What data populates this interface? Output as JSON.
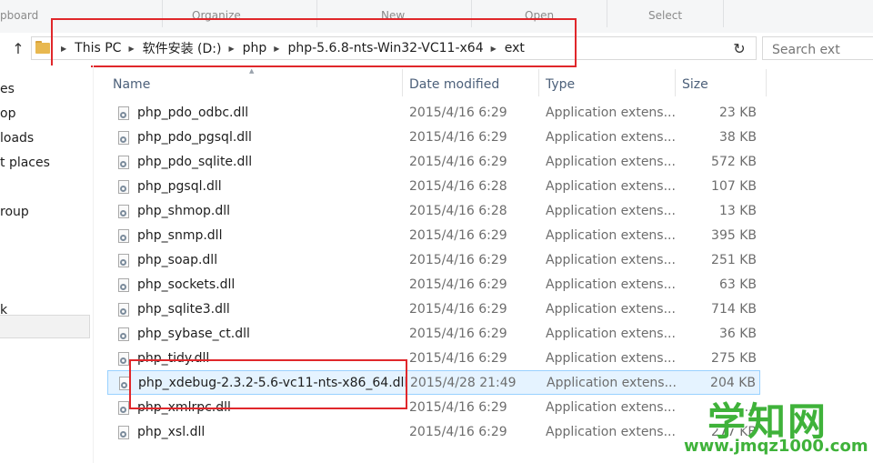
{
  "ribbon": {
    "groups": [
      "pboard",
      "Organize",
      "New",
      "Open",
      "Select"
    ]
  },
  "address": {
    "crumbs": [
      "This PC",
      "软件安装 (D:)",
      "php",
      "php-5.6.8-nts-Win32-VC11-x64",
      "ext"
    ]
  },
  "search": {
    "placeholder": "Search ext"
  },
  "nav": {
    "items": [
      "es",
      "op",
      "loads",
      "t places",
      "roup",
      "k"
    ]
  },
  "columns": {
    "name": "Name",
    "date": "Date modified",
    "type": "Type",
    "size": "Size"
  },
  "files": [
    {
      "name": "php_pdo_odbc.dll",
      "date": "2015/4/16 6:29",
      "type": "Application extens...",
      "size": "23 KB"
    },
    {
      "name": "php_pdo_pgsql.dll",
      "date": "2015/4/16 6:29",
      "type": "Application extens...",
      "size": "38 KB"
    },
    {
      "name": "php_pdo_sqlite.dll",
      "date": "2015/4/16 6:29",
      "type": "Application extens...",
      "size": "572 KB"
    },
    {
      "name": "php_pgsql.dll",
      "date": "2015/4/16 6:28",
      "type": "Application extens...",
      "size": "107 KB"
    },
    {
      "name": "php_shmop.dll",
      "date": "2015/4/16 6:28",
      "type": "Application extens...",
      "size": "13 KB"
    },
    {
      "name": "php_snmp.dll",
      "date": "2015/4/16 6:29",
      "type": "Application extens...",
      "size": "395 KB"
    },
    {
      "name": "php_soap.dll",
      "date": "2015/4/16 6:29",
      "type": "Application extens...",
      "size": "251 KB"
    },
    {
      "name": "php_sockets.dll",
      "date": "2015/4/16 6:29",
      "type": "Application extens...",
      "size": "63 KB"
    },
    {
      "name": "php_sqlite3.dll",
      "date": "2015/4/16 6:29",
      "type": "Application extens...",
      "size": "714 KB"
    },
    {
      "name": "php_sybase_ct.dll",
      "date": "2015/4/16 6:29",
      "type": "Application extens...",
      "size": "36 KB"
    },
    {
      "name": "php_tidy.dll",
      "date": "2015/4/16 6:29",
      "type": "Application extens...",
      "size": "275 KB"
    },
    {
      "name": "php_xdebug-2.3.2-5.6-vc11-nts-x86_64.dll",
      "date": "2015/4/28 21:49",
      "type": "Application extens...",
      "size": "204 KB"
    },
    {
      "name": "php_xmlrpc.dll",
      "date": "2015/4/16 6:29",
      "type": "Application extens...",
      "size": "..."
    },
    {
      "name": "php_xsl.dll",
      "date": "2015/4/16 6:29",
      "type": "Application extens...",
      "size": "277 KB"
    }
  ],
  "watermark": {
    "big": "学知网",
    "small": "www.jmqz1000.com"
  },
  "colors": {
    "highlight": "#e0272b",
    "selected_row": "#e5f3ff",
    "watermark": "#3fb23a"
  }
}
